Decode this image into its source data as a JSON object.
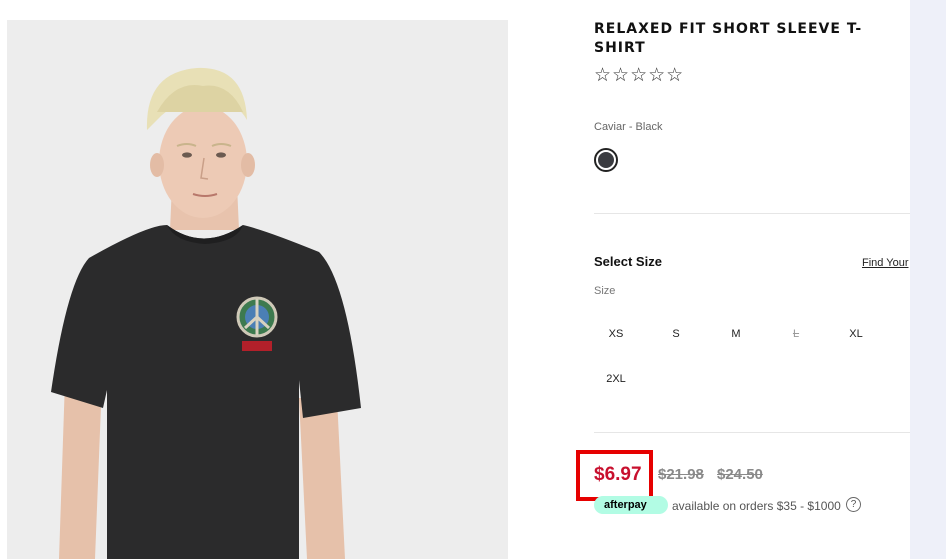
{
  "product": {
    "title": "RELAXED FIT SHORT SLEEVE T-SHIRT",
    "rating_stars": "☆☆☆☆☆",
    "color_label": "Caviar - Black",
    "swatch_color": "#3a3b40"
  },
  "size": {
    "heading": "Select Size",
    "find_link": "Find Your",
    "sub_label": "Size",
    "options": [
      {
        "label": "XS",
        "available": true
      },
      {
        "label": "S",
        "available": true
      },
      {
        "label": "M",
        "available": true
      },
      {
        "label": "L",
        "available": false
      },
      {
        "label": "XL",
        "available": true
      },
      {
        "label": "2XL",
        "available": true
      }
    ]
  },
  "price": {
    "sale": "$6.97",
    "original_1": "$21.98",
    "original_2": "$24.50",
    "sale_color": "#c8102e",
    "highlight_color": "#e60000"
  },
  "afterpay": {
    "logo_text": "afterpay",
    "text": "available on orders $35 - $1000",
    "info_icon": "?"
  }
}
